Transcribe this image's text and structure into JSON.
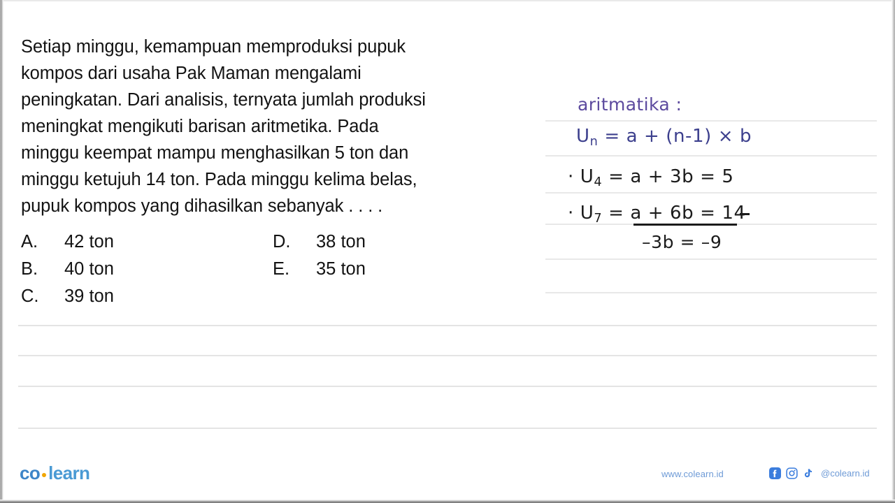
{
  "question": {
    "lines": [
      "Setiap minggu, kemampuan memproduksi pupuk",
      "kompos dari usaha Pak Maman mengalami",
      "peningkatan. Dari analisis, ternyata jumlah produksi",
      "meningkat mengikuti barisan aritmetika. Pada",
      "minggu keempat mampu menghasilkan 5 ton dan",
      "minggu ketujuh 14 ton. Pada minggu kelima belas,",
      "pupuk kompos yang dihasilkan sebanyak . . . ."
    ]
  },
  "options": [
    {
      "label": "A.",
      "text": "42 ton"
    },
    {
      "label": "B.",
      "text": "40 ton"
    },
    {
      "label": "C.",
      "text": "39 ton"
    },
    {
      "label": "D.",
      "text": "38 ton"
    },
    {
      "label": "E.",
      "text": "35 ton"
    }
  ],
  "notes": {
    "title": "aritmatika :",
    "formula_lhs": "U",
    "formula_sub": "n",
    "formula_rhs": " = a + (n-1) × b",
    "step1_bullet": "· U",
    "step1_sub": "4",
    "step1_rhs": " = a + 3b = 5",
    "step2_bullet": "· U",
    "step2_sub": "7",
    "step2_rhs": " = a + 6b = 14",
    "result": "–3b = –9",
    "title_color": "#5c4a9e",
    "formula_color": "#3c3f8d",
    "ink_color": "#1b1b1b"
  },
  "footer": {
    "logo_part1": "co",
    "logo_part2": "learn",
    "url": "www.colearn.id",
    "handle": "@colearn.id",
    "icons": [
      "facebook-icon",
      "instagram-icon",
      "tiktok-icon"
    ],
    "brand_blue": "#3d85c8",
    "accent_orange": "#f0a500",
    "link_blue": "#6d9ad6"
  },
  "rules": {
    "full_width": [
      465,
      508,
      552,
      612
    ],
    "note_panel": [
      172,
      222,
      275,
      320,
      370,
      418
    ]
  }
}
